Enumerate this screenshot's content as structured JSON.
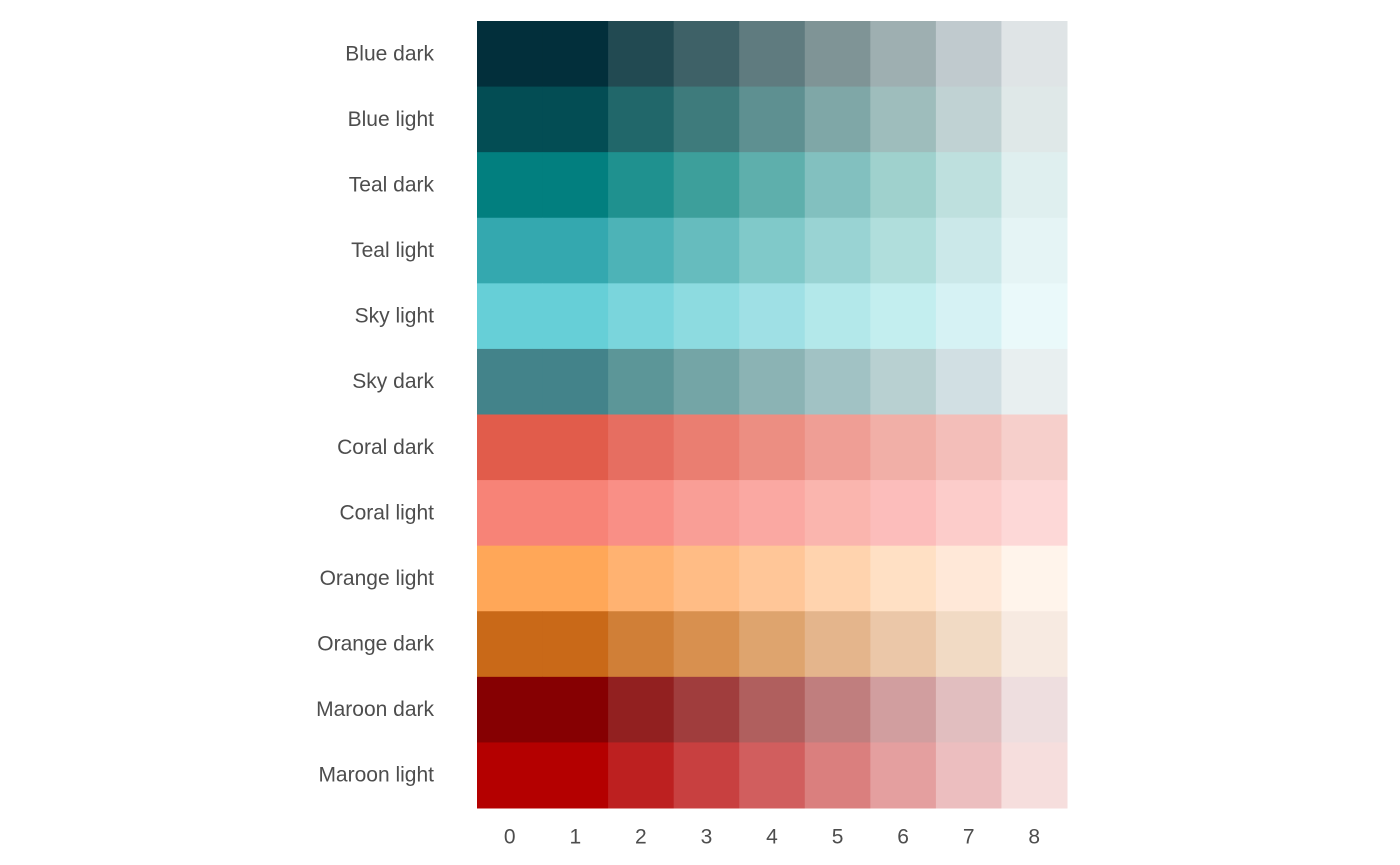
{
  "chart_data": {
    "type": "heatmap",
    "columns": [
      "0",
      "1",
      "2",
      "3",
      "4",
      "5",
      "6",
      "7",
      "8"
    ],
    "rows": [
      {
        "name": "Blue dark",
        "colors": [
          "#022F3B",
          "#022F3B",
          "#224A52",
          "#3E6167",
          "#5F7B7F",
          "#7F9496",
          "#9EAFB1",
          "#C0CACE",
          "#DFE4E6"
        ]
      },
      {
        "name": "Blue light",
        "colors": [
          "#034D54",
          "#034D54",
          "#21676A",
          "#3E7B7C",
          "#5E9091",
          "#7FA7A7",
          "#9EBDBC",
          "#C0D2D3",
          "#DFE8E8"
        ]
      },
      {
        "name": "Teal dark",
        "colors": [
          "#027F7F",
          "#027F7F",
          "#1F918F",
          "#3D9F9B",
          "#5EAFAC",
          "#82C0BF",
          "#9FD1CD",
          "#BEE0DE",
          "#DFEFEF"
        ]
      },
      {
        "name": "Teal light",
        "colors": [
          "#34A8AF",
          "#34A8AF",
          "#4DB3B7",
          "#66BCBE",
          "#80C9C9",
          "#99D3D3",
          "#B0DEDC",
          "#CBE8E9",
          "#E5F4F5"
        ]
      },
      {
        "name": "Sky light",
        "colors": [
          "#66CFD7",
          "#66CFD7",
          "#7AD5DC",
          "#8DDBE0",
          "#9FE0E5",
          "#B3E8EA",
          "#C3EEEF",
          "#D6F2F4",
          "#EAF9FA"
        ]
      },
      {
        "name": "Sky dark",
        "colors": [
          "#43838A",
          "#43838A",
          "#5C9698",
          "#74A5A6",
          "#8BB3B4",
          "#A1C2C4",
          "#B8D0D1",
          "#D1DFE3",
          "#E8EFF0"
        ]
      },
      {
        "name": "Coral dark",
        "colors": [
          "#E15C4B",
          "#E15C4B",
          "#E66E61",
          "#EA7E71",
          "#EC8E82",
          "#EF9E95",
          "#F1AFA7",
          "#F3BEB9",
          "#F6CFCB"
        ]
      },
      {
        "name": "Coral light",
        "colors": [
          "#F78377",
          "#F78377",
          "#F98F86",
          "#F99E96",
          "#FAA8A2",
          "#FAB5AE",
          "#FCBDBB",
          "#FCCCCA",
          "#FDD8D7"
        ]
      },
      {
        "name": "Orange light",
        "colors": [
          "#FFA758",
          "#FFA758",
          "#FFB271",
          "#FFBC85",
          "#FFC698",
          "#FFD3AE",
          "#FFE0C4",
          "#FFE8D8",
          "#FFF4EB"
        ]
      },
      {
        "name": "Orange dark",
        "colors": [
          "#C96918",
          "#C96918",
          "#D07F37",
          "#D8904F",
          "#DEA46E",
          "#E4B58C",
          "#EBC7A8",
          "#F1DAC4",
          "#F7EAE1"
        ]
      },
      {
        "name": "Maroon dark",
        "colors": [
          "#860002",
          "#860002",
          "#922020",
          "#A03D3D",
          "#B05F5E",
          "#C07E7E",
          "#D19E9F",
          "#E1BEBF",
          "#EEDEDF"
        ]
      },
      {
        "name": "Maroon light",
        "colors": [
          "#B40000",
          "#B40000",
          "#BD2020",
          "#C84040",
          "#D15E5E",
          "#DA7F7E",
          "#E49F9F",
          "#ECBEBF",
          "#F6DEDD"
        ]
      }
    ]
  }
}
